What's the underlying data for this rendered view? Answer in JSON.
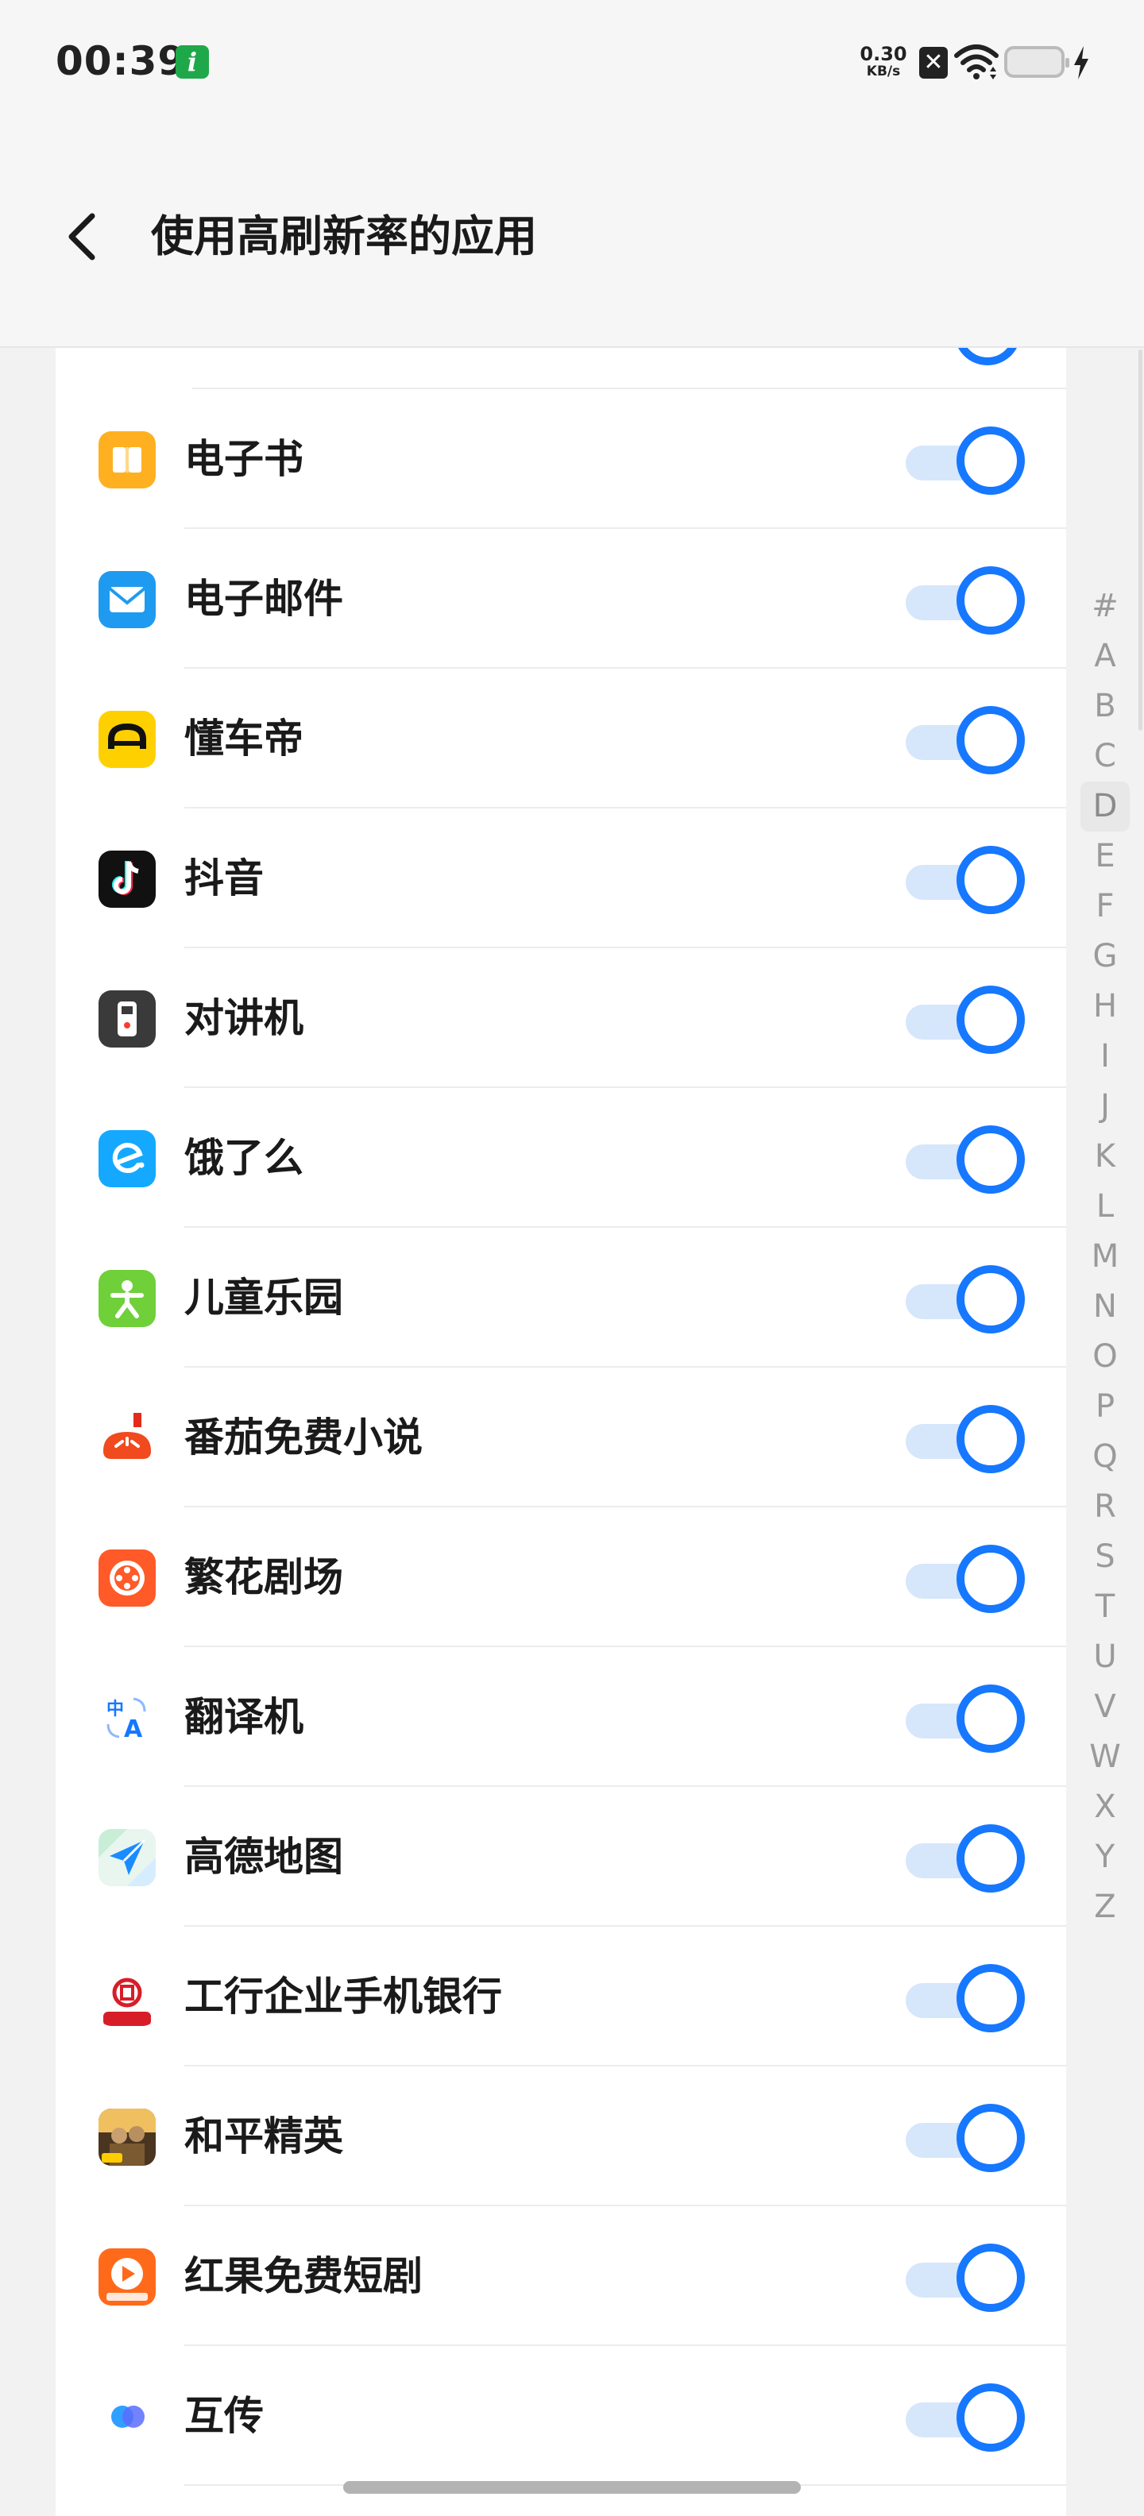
{
  "status_bar": {
    "time": "00:39",
    "info_badge": "i",
    "net_speed_value": "0.30",
    "net_speed_unit": "KB/s"
  },
  "header": {
    "title": "使用高刷新率的应用"
  },
  "apps": [
    {
      "name": "电子书",
      "enabled": true,
      "icon": "ebook-icon",
      "color": "#ffb020"
    },
    {
      "name": "电子邮件",
      "enabled": true,
      "icon": "mail-icon",
      "color": "#1e9bf0"
    },
    {
      "name": "懂车帝",
      "enabled": true,
      "icon": "dongchedi-icon",
      "color": "#ffd000"
    },
    {
      "name": "抖音",
      "enabled": true,
      "icon": "douyin-icon",
      "color": "#111111"
    },
    {
      "name": "对讲机",
      "enabled": true,
      "icon": "walkie-talkie-icon",
      "color": "#3a3a3a"
    },
    {
      "name": "饿了么",
      "enabled": true,
      "icon": "eleme-icon",
      "color": "#14a9ff"
    },
    {
      "name": "儿童乐园",
      "enabled": true,
      "icon": "kids-park-icon",
      "color": "#6fd03a"
    },
    {
      "name": "番茄免费小说",
      "enabled": true,
      "icon": "tomato-novel-icon",
      "color": "#f04a1e"
    },
    {
      "name": "繁花剧场",
      "enabled": true,
      "icon": "fanhua-theater-icon",
      "color": "#ff5a28"
    },
    {
      "name": "翻译机",
      "enabled": true,
      "icon": "translator-icon",
      "color": "#1677ff"
    },
    {
      "name": "高德地图",
      "enabled": true,
      "icon": "amap-icon",
      "color": "#1a8cff"
    },
    {
      "name": "工行企业手机银行",
      "enabled": true,
      "icon": "icbc-icon",
      "color": "#d71e28"
    },
    {
      "name": "和平精英",
      "enabled": true,
      "icon": "peace-elite-icon",
      "color": "#7a5a30"
    },
    {
      "name": "红果免费短剧",
      "enabled": true,
      "icon": "hongguo-icon",
      "color": "#ff6a1a"
    },
    {
      "name": "互传",
      "enabled": true,
      "icon": "share-icon",
      "color": "#5b6cff"
    }
  ],
  "alphabet_index": [
    "#",
    "A",
    "B",
    "C",
    "D",
    "E",
    "F",
    "G",
    "H",
    "I",
    "J",
    "K",
    "L",
    "M",
    "N",
    "O",
    "P",
    "Q",
    "R",
    "S",
    "T",
    "U",
    "V",
    "W",
    "X",
    "Y",
    "Z"
  ],
  "alphabet_active": "D",
  "colors": {
    "accent": "#1677ff",
    "track": "#d6e6fb"
  }
}
